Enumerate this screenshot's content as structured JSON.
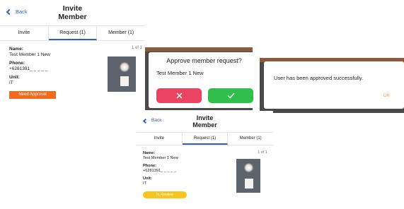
{
  "screen_before": {
    "back_label": "Back",
    "title_line1": "Invite",
    "title_line2": "Member",
    "tabs": [
      {
        "label": "Invite"
      },
      {
        "label": "Request (1)"
      },
      {
        "label": "Member (1)"
      }
    ],
    "pager": "1 of 1",
    "name_label": "Name:",
    "name_value": "Test Member 1 New",
    "phone_label": "Phone:",
    "phone_value": "+6281391_ _ _ _ _",
    "unit_label": "Unit:",
    "unit_value": "IT",
    "status_badge": "Need Approval"
  },
  "approve_dialog": {
    "title": "Approve member request?",
    "member_name": "Test Member 1 New",
    "reject_icon": "close-icon",
    "approve_icon": "check-icon",
    "reject_color": "#ea4460",
    "approve_color": "#2fbf4a"
  },
  "success_dialog": {
    "message": "User has been approved successfully.",
    "ok_label": "OK"
  },
  "screen_after": {
    "back_label": "Back",
    "title_line1": "Invite",
    "title_line2": "Member",
    "tabs": [
      {
        "label": "Invite"
      },
      {
        "label": "Request (1)"
      },
      {
        "label": "Member (1)"
      }
    ],
    "pager": "1 of 1",
    "name_label": "Name:",
    "name_value": "Test Member 1 New",
    "phone_label": "Phone:",
    "phone_value": "+6281391_ _ _ _ _",
    "unit_label": "Unit:",
    "unit_value": "IT",
    "status_badge": "In Review"
  },
  "colors": {
    "accent": "#2f5fc7",
    "need_approval": "#f46a1b",
    "in_review": "#f6c61e"
  }
}
